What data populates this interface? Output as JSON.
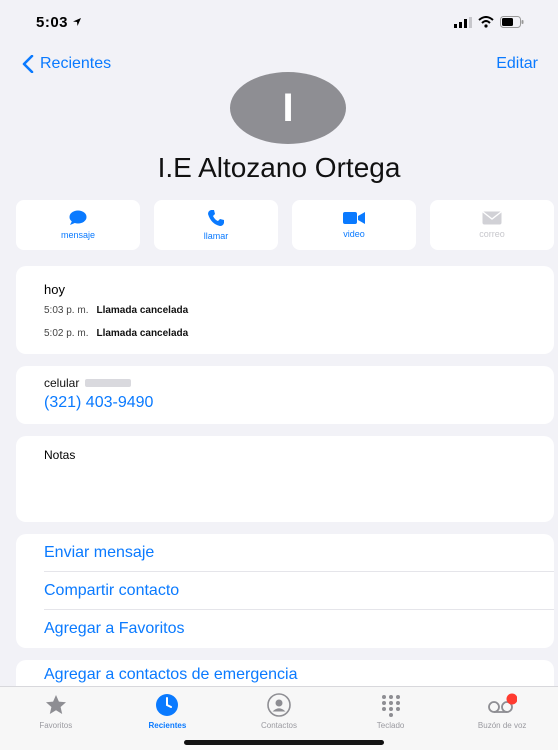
{
  "status_bar": {
    "time": "5:03"
  },
  "nav": {
    "back_label": "Recientes",
    "edit_label": "Editar"
  },
  "contact": {
    "initial": "I",
    "name": "I.E Altozano Ortega"
  },
  "actions": [
    {
      "label": "mensaje",
      "icon": "message-bubble-icon"
    },
    {
      "label": "llamar",
      "icon": "phone-icon"
    },
    {
      "label": "video",
      "icon": "video-camera-icon"
    },
    {
      "label": "correo",
      "icon": "mail-icon",
      "disabled": true
    }
  ],
  "history": {
    "day": "hoy",
    "calls": [
      {
        "time": "5:03 p. m.",
        "status": "Llamada cancelada"
      },
      {
        "time": "5:02 p. m.",
        "status": "Llamada cancelada"
      }
    ]
  },
  "phone": {
    "label": "celular",
    "number": "(321) 403-9490"
  },
  "notes": {
    "label": "Notas"
  },
  "links": {
    "send_message": "Enviar mensaje",
    "share_contact": "Compartir contacto",
    "add_favorites": "Agregar a Favoritos",
    "add_emergency": "Agregar a contactos de emergencia"
  },
  "tabs": [
    {
      "label": "Favoritos",
      "icon": "star-icon"
    },
    {
      "label": "Recientes",
      "icon": "clock-icon",
      "active": true
    },
    {
      "label": "Contactos",
      "icon": "contacts-icon"
    },
    {
      "label": "Teclado",
      "icon": "keypad-icon"
    },
    {
      "label": "Buzón de voz",
      "icon": "voicemail-icon"
    }
  ],
  "colors": {
    "accent": "#0a7aff",
    "background": "#f2f2f7",
    "avatar": "#8e8e93",
    "badge": "#ff3b30"
  }
}
